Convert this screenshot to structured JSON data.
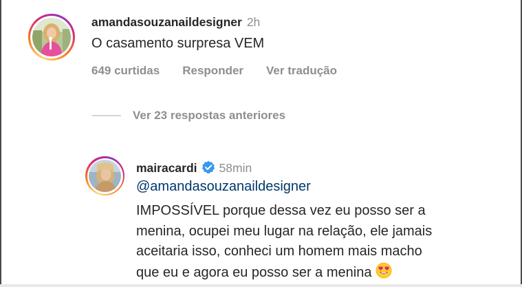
{
  "comment_1": {
    "username": "amandasouzanaildesigner",
    "timestamp": "2h",
    "text": "O casamento surpresa VEM",
    "actions": {
      "likes": "649 curtidas",
      "reply": "Responder",
      "translate": "Ver tradução"
    }
  },
  "view_previous_replies": "Ver 23 respostas anteriores",
  "comment_2": {
    "username": "mairacardi",
    "verified": true,
    "timestamp": "58min",
    "mention": "@amandasouzanaildesigner",
    "text_lines": [
      "IMPOSSÍVEL porque dessa vez eu posso ser a",
      "menina, ocupei meu lugar na relação, ele jamais",
      "aceitaria isso, conheci um homem mais macho",
      "que eu e agora eu posso ser a menina"
    ],
    "emoji": "smiling-face-with-heart-eyes"
  },
  "colors": {
    "text_primary": "#262626",
    "text_secondary": "#8e8e8e",
    "mention_link": "#00376b",
    "verified_badge": "#3897f0"
  }
}
